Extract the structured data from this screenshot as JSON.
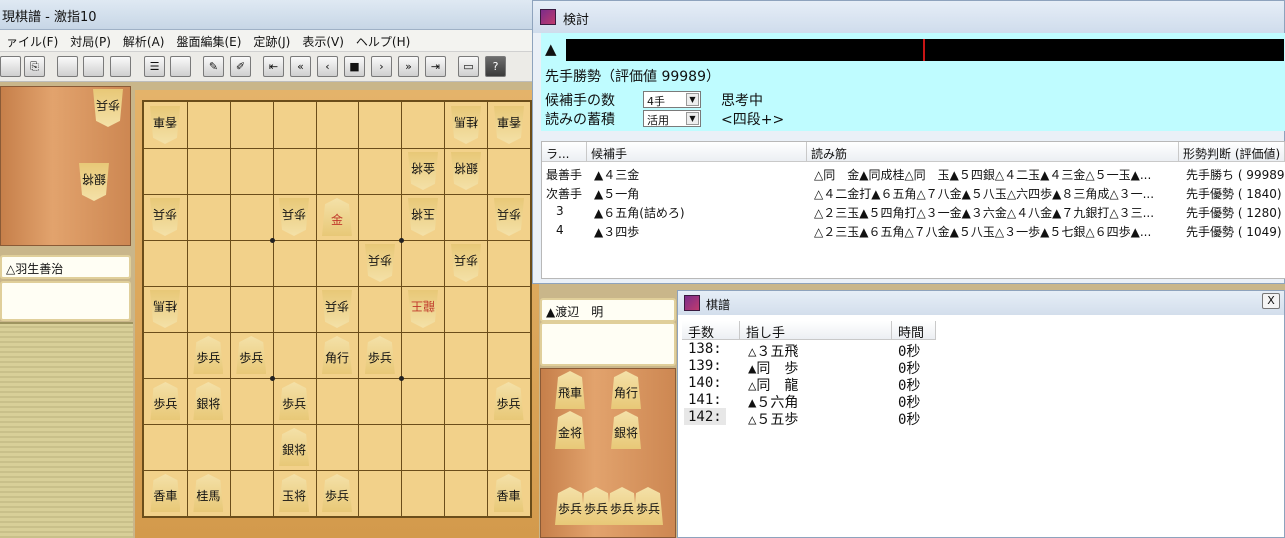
{
  "main_window": {
    "title": "現棋譜 - 激指10",
    "menu": [
      "ァイル(F)",
      "対局(P)",
      "解析(A)",
      "盤面編集(E)",
      "定跡(J)",
      "表示(V)",
      "ヘルプ(H)"
    ],
    "white_player": "△羽生善治",
    "black_player": "▲渡辺　明"
  },
  "analysis": {
    "title": "検討",
    "triangle": "▲",
    "status": "先手勝勢（評価値 99989）",
    "candidates_label": "候補手の数",
    "candidates_value": "4手",
    "thinking": "思考中",
    "accumulate_label": "読みの蓄積",
    "accumulate_value": "活用",
    "level": "<四段+>",
    "columns": [
      "ラ...",
      "候補手",
      "読み筋",
      "形勢判断 (評価値)"
    ],
    "rows": [
      {
        "rank": "最善手",
        "move": "▲４三金",
        "line": "△同　金▲同成桂△同　玉▲５四銀△４二玉▲４三金△５一玉▲...",
        "eval": "先手勝ち ( 99989)"
      },
      {
        "rank": "次善手",
        "move": "▲５一角",
        "line": "△４二金打▲６五角△７八金▲５八玉△六四歩▲８三角成△３一...",
        "eval": "先手優勢 (  1840)"
      },
      {
        "rank": "3",
        "move": "▲６五角(詰めろ)",
        "line": "△２三玉▲５四角打△３一金▲３六金△４八金▲７九銀打△３三...",
        "eval": "先手優勢 (  1280)"
      },
      {
        "rank": "4",
        "move": "▲３四歩",
        "line": "△２三玉▲６五角△７八金▲５八玉△３一歩▲５七銀△６四歩▲...",
        "eval": "先手優勢 (  1049)"
      }
    ]
  },
  "kifu": {
    "title": "棋譜",
    "close": "X",
    "columns": [
      "手数",
      "指し手",
      "時間"
    ],
    "rows": [
      {
        "num": "138:",
        "move": "△３五飛",
        "time": "0秒"
      },
      {
        "num": "139:",
        "move": "▲同　歩",
        "time": "0秒"
      },
      {
        "num": "140:",
        "move": "△同　龍",
        "time": "0秒"
      },
      {
        "num": "141:",
        "move": "▲５六角",
        "time": "0秒"
      },
      {
        "num": "142:",
        "move": "△５五歩",
        "time": "0秒"
      }
    ]
  },
  "board": {
    "pieces": [
      {
        "t": "香車",
        "c": 0,
        "r": 0,
        "rev": true
      },
      {
        "t": "桂馬",
        "c": 7,
        "r": 0,
        "rev": true
      },
      {
        "t": "香車",
        "c": 8,
        "r": 0,
        "rev": true
      },
      {
        "t": "金将",
        "c": 6,
        "r": 1,
        "rev": true
      },
      {
        "t": "銀将",
        "c": 7,
        "r": 1,
        "rev": true
      },
      {
        "t": "歩兵",
        "c": 0,
        "r": 2,
        "rev": true
      },
      {
        "t": "歩兵",
        "c": 3,
        "r": 2,
        "rev": true
      },
      {
        "t": "金",
        "c": 4,
        "r": 2,
        "rev": false,
        "red": true
      },
      {
        "t": "玉将",
        "c": 6,
        "r": 2,
        "rev": true
      },
      {
        "t": "歩兵",
        "c": 8,
        "r": 2,
        "rev": true
      },
      {
        "t": "歩兵",
        "c": 5,
        "r": 3,
        "rev": true
      },
      {
        "t": "歩兵",
        "c": 7,
        "r": 3,
        "rev": true
      },
      {
        "t": "桂馬",
        "c": 0,
        "r": 4,
        "rev": true
      },
      {
        "t": "歩兵",
        "c": 4,
        "r": 4,
        "rev": true
      },
      {
        "t": "龍王",
        "c": 6,
        "r": 4,
        "rev": true,
        "red": true
      },
      {
        "t": "歩兵",
        "c": 1,
        "r": 5,
        "rev": false
      },
      {
        "t": "歩兵",
        "c": 2,
        "r": 5,
        "rev": false
      },
      {
        "t": "角行",
        "c": 4,
        "r": 5,
        "rev": false
      },
      {
        "t": "歩兵",
        "c": 5,
        "r": 5,
        "rev": false
      },
      {
        "t": "歩兵",
        "c": 0,
        "r": 6,
        "rev": false
      },
      {
        "t": "銀将",
        "c": 1,
        "r": 6,
        "rev": false
      },
      {
        "t": "歩兵",
        "c": 3,
        "r": 6,
        "rev": false
      },
      {
        "t": "歩兵",
        "c": 8,
        "r": 6,
        "rev": false
      },
      {
        "t": "銀将",
        "c": 3,
        "r": 7,
        "rev": false
      },
      {
        "t": "香車",
        "c": 0,
        "r": 8,
        "rev": false
      },
      {
        "t": "桂馬",
        "c": 1,
        "r": 8,
        "rev": false
      },
      {
        "t": "玉将",
        "c": 3,
        "r": 8,
        "rev": false
      },
      {
        "t": "歩兵",
        "c": 4,
        "r": 8,
        "rev": false
      },
      {
        "t": "香車",
        "c": 8,
        "r": 8,
        "rev": false
      }
    ],
    "white_hand": [
      "歩兵",
      "銀将"
    ],
    "black_hand": [
      "飛車",
      "角行",
      "金将",
      "銀将",
      "歩兵",
      "歩兵",
      "歩兵",
      "歩兵"
    ]
  }
}
